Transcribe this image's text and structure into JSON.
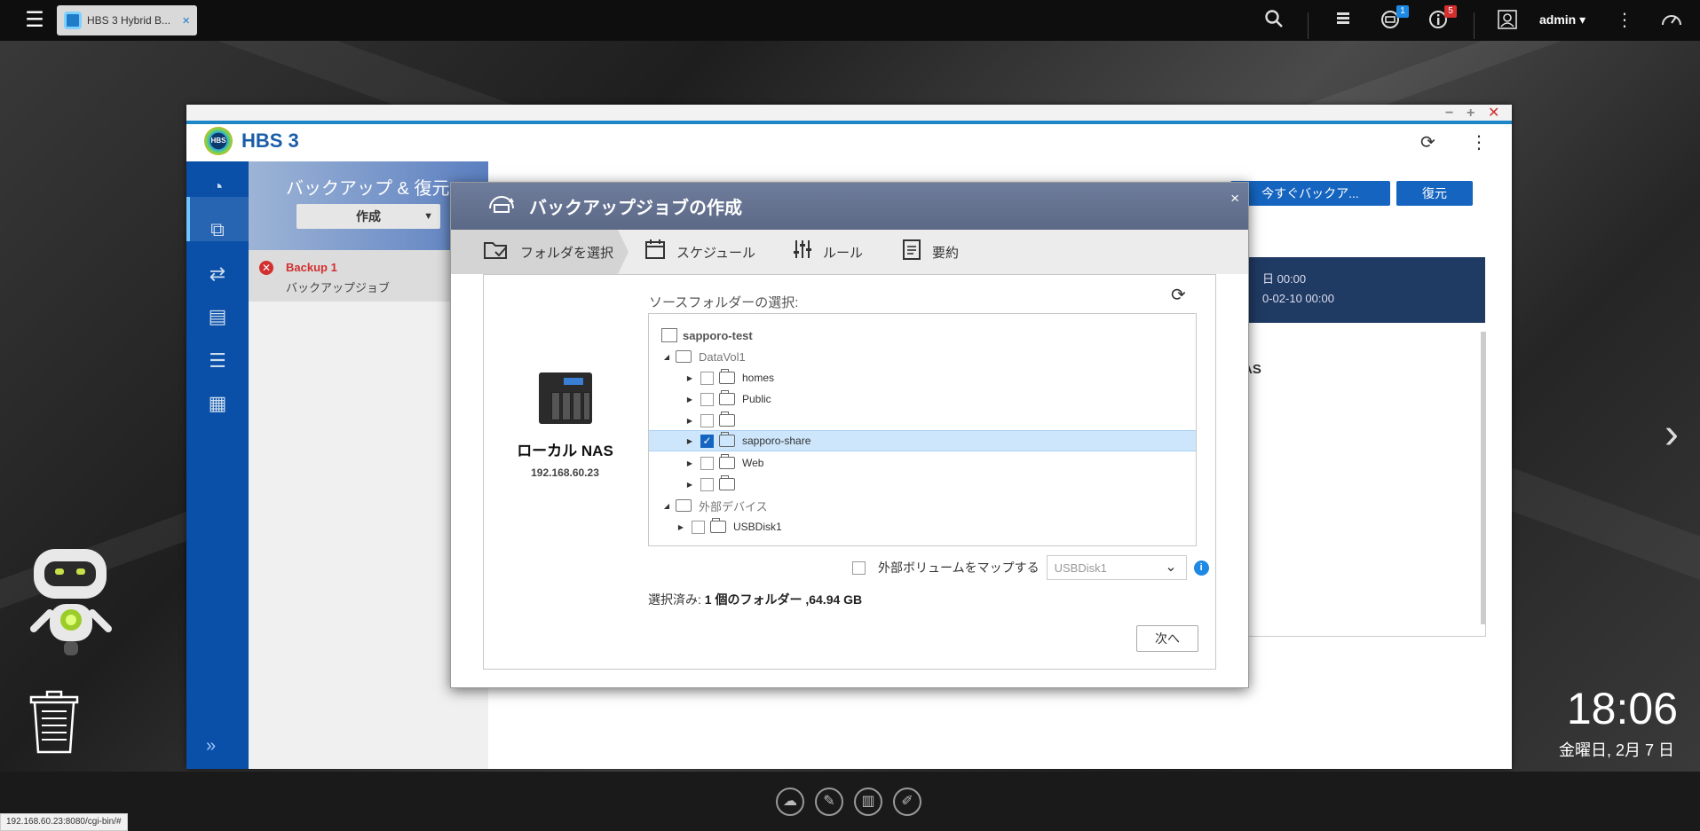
{
  "topbar": {
    "tab_label": "HBS 3 Hybrid B...",
    "tab_close": "×",
    "notif_badge": "1",
    "info_badge": "5",
    "user": "admin ▾",
    "icons": [
      "search-icon",
      "stack-icon",
      "notification-icon",
      "info-icon",
      "user-icon",
      "more-icon",
      "dashboard-icon"
    ]
  },
  "app": {
    "title": "HBS 3",
    "section_title": "バックアップ & 復元",
    "create_button": "作成",
    "job_name": "Backup 1",
    "job_type": "バックアップジョブ",
    "backup_now_button": "今すぐバックア...",
    "restore_button": "復元",
    "schedule_line1": "日 00:00",
    "schedule_line2": "0-02-10 00:00",
    "dest_label": "AS"
  },
  "dialog": {
    "title": "バックアップジョブの作成",
    "close": "×",
    "steps": [
      {
        "label": "フォルダを選択"
      },
      {
        "label": "スケジュール"
      },
      {
        "label": "ルール"
      },
      {
        "label": "要約"
      }
    ],
    "local_nas_label": "ローカル NAS",
    "local_nas_ip": "192.168.60.23",
    "source_label": "ソースフォルダーの選択:",
    "tree": [
      {
        "label": "sapporo-test",
        "type": "server",
        "indent": 0,
        "arrow": "",
        "checkbox": false,
        "checked": false
      },
      {
        "label": "DataVol1",
        "type": "drive",
        "indent": 1,
        "arrow": "◢",
        "checkbox": false,
        "checked": false
      },
      {
        "label": "homes",
        "type": "folder",
        "indent": 2,
        "arrow": "▶",
        "checkbox": true,
        "checked": false
      },
      {
        "label": "Public",
        "type": "folder",
        "indent": 2,
        "arrow": "▶",
        "checkbox": true,
        "checked": false
      },
      {
        "label": "",
        "type": "folder",
        "indent": 2,
        "arrow": "▶",
        "checkbox": true,
        "checked": false
      },
      {
        "label": "sapporo-share",
        "type": "folder",
        "indent": 2,
        "arrow": "▶",
        "checkbox": true,
        "checked": true,
        "selected": true
      },
      {
        "label": "Web",
        "type": "folder",
        "indent": 2,
        "arrow": "▶",
        "checkbox": true,
        "checked": false
      },
      {
        "label": "",
        "type": "folder",
        "indent": 2,
        "arrow": "▶",
        "checkbox": true,
        "checked": false
      },
      {
        "label": "外部デバイス",
        "type": "drive",
        "indent": 1,
        "arrow": "◢",
        "checkbox": false,
        "checked": false
      },
      {
        "label": "USBDisk1",
        "type": "folder",
        "indent": 2,
        "arrow": "▶",
        "checkbox": true,
        "checked": false
      }
    ],
    "map_label": "外部ボリュームをマップする",
    "map_select_value": "USBDisk1",
    "selected_prefix": "選択済み:",
    "selected_value": "1 個のフォルダー ,64.94 GB",
    "next_button": "次へ"
  },
  "desktop": {
    "time": "18:06",
    "date": "金曜日, 2月 7 日",
    "url": "192.168.60.23:8080/cgi-bin/#"
  },
  "colors": {
    "accent": "#1565c0",
    "error": "#d32f2f",
    "dialog_header": "#5b6886"
  }
}
